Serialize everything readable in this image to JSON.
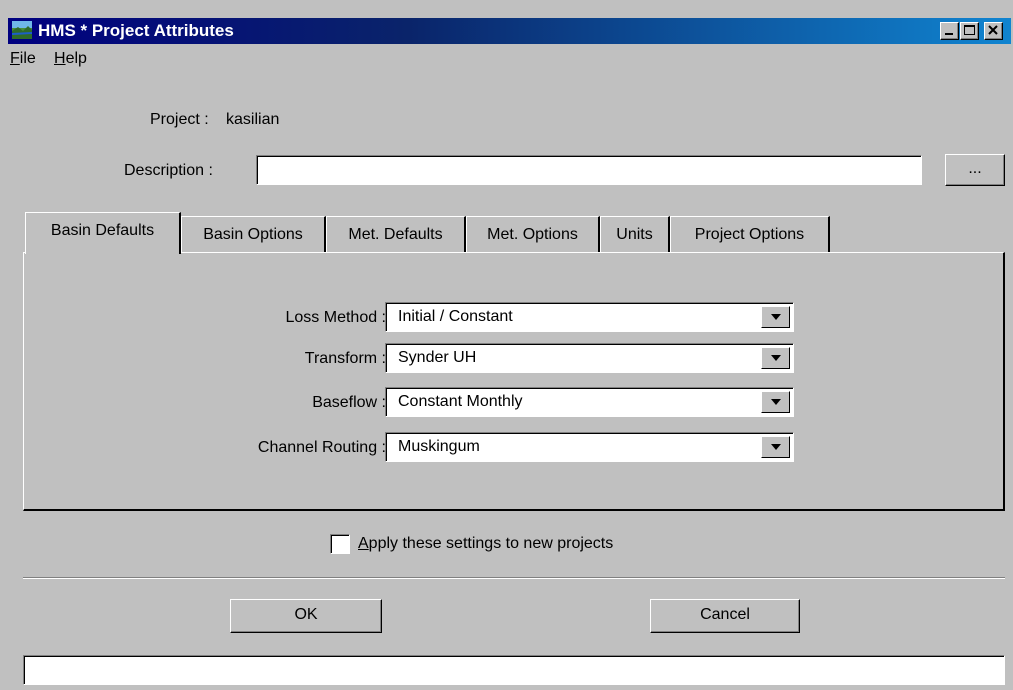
{
  "window": {
    "title": "HMS * Project Attributes"
  },
  "menu": {
    "items": [
      {
        "label_prefix": "",
        "mnemonic": "F",
        "label_rest": "ile"
      },
      {
        "label_prefix": "",
        "mnemonic": "H",
        "label_rest": "elp"
      }
    ]
  },
  "project": {
    "label": "Project :",
    "name": "kasilian"
  },
  "description": {
    "label": "Description :",
    "value": "",
    "browse_label": "..."
  },
  "tabs": [
    {
      "label": "Basin Defaults",
      "active": true
    },
    {
      "label": "Basin Options",
      "active": false
    },
    {
      "label": "Met. Defaults",
      "active": false
    },
    {
      "label": "Met. Options",
      "active": false
    },
    {
      "label": "Units",
      "active": false
    },
    {
      "label": "Project Options",
      "active": false
    }
  ],
  "basin_defaults": {
    "fields": [
      {
        "label": "Loss Method :",
        "value": "Initial / Constant"
      },
      {
        "label": "Transform :",
        "value": "Synder UH"
      },
      {
        "label": "Baseflow :",
        "value": "Constant Monthly"
      },
      {
        "label": "Channel Routing :",
        "value": "Muskingum"
      }
    ]
  },
  "apply_settings": {
    "label_prefix": "",
    "mnemonic": "A",
    "label_rest": "pply these settings to new projects",
    "checked": false
  },
  "buttons": {
    "ok": "OK",
    "cancel": "Cancel"
  },
  "status": {
    "text": ""
  }
}
